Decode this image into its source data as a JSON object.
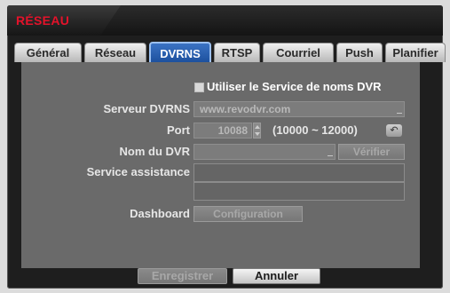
{
  "window": {
    "title": "RÉSEAU"
  },
  "tabs": [
    {
      "label": "Général"
    },
    {
      "label": "Réseau"
    },
    {
      "label": "DVRNS"
    },
    {
      "label": "RTSP"
    },
    {
      "label": "Courriel"
    },
    {
      "label": "Push"
    },
    {
      "label": "Planifier"
    }
  ],
  "active_tab": "DVRNS",
  "form": {
    "use_service_label": "Utiliser le Service de noms DVR",
    "use_service_checked": true,
    "server_label": "Serveur DVRNS",
    "server_value": "www.revodvr.com",
    "port_label": "Port",
    "port_value": "10088",
    "port_range": "(10000 ~ 12000)",
    "dvr_name_label": "Nom du DVR",
    "dvr_name_value": "",
    "verify_label": "Vérifier",
    "help_label": "Service assistance",
    "dashboard_label": "Dashboard",
    "configuration_label": "Configuration"
  },
  "footer": {
    "save_label": "Enregistrer",
    "cancel_label": "Annuler"
  },
  "icons": {
    "undo": "undo-arrow-icon",
    "spinner": "spinner-icon"
  }
}
